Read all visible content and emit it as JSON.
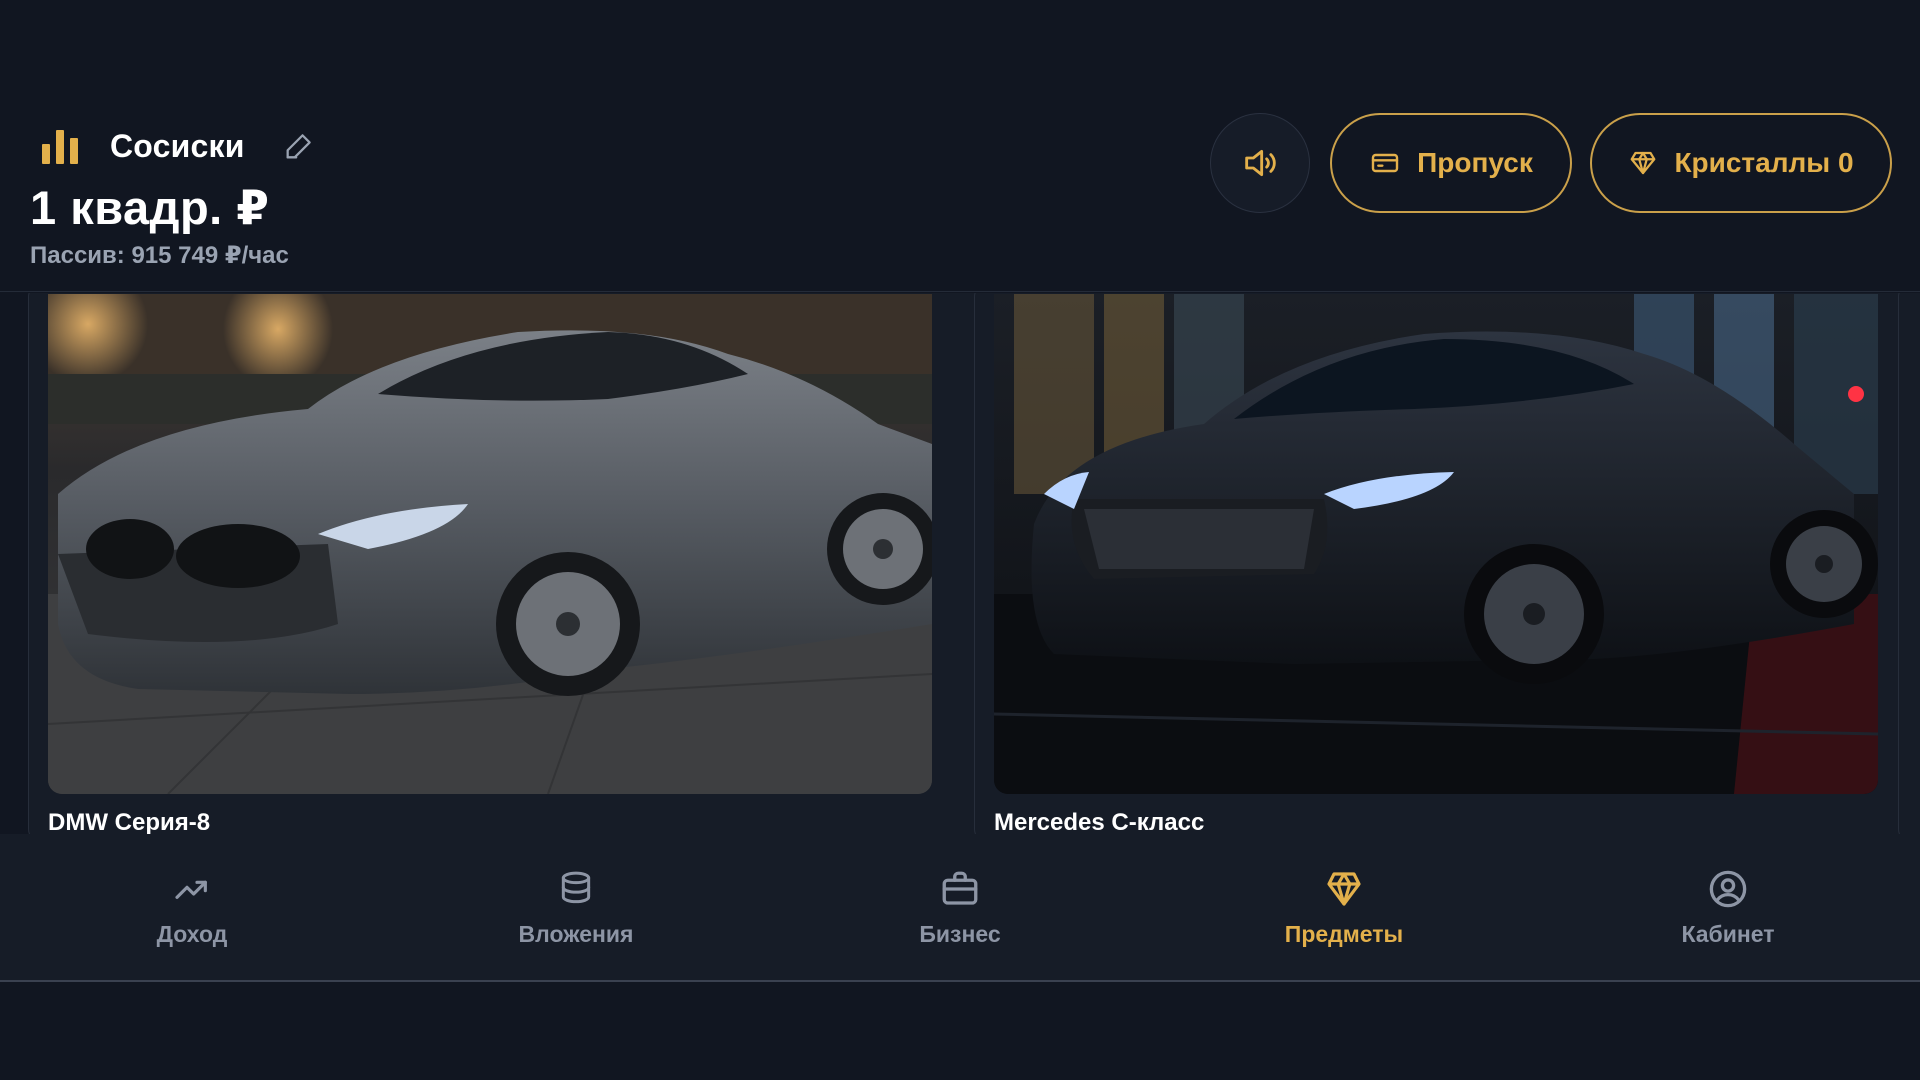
{
  "header": {
    "group_icon": "bar-chart-icon",
    "group_name": "Сосиски",
    "edit_icon": "pencil-icon",
    "balance": "1 квадр. ₽",
    "passive": "Пассив: 915 749 ₽/час",
    "sound_icon": "speaker-icon",
    "pass_button": {
      "icon": "ticket-icon",
      "label": "Пропуск"
    },
    "crystals_button": {
      "icon": "diamond-icon",
      "label": "Кристаллы 0"
    }
  },
  "items": [
    {
      "title": "DMW Серия-8",
      "image": "grey BMW 8 series coupe parked on cobblestones at dusk"
    },
    {
      "title": "Mercedes C-класс",
      "image": "black Mercedes C-class on wet city street at night"
    }
  ],
  "nav": {
    "active_tab": "Предметы",
    "items": [
      {
        "label": "Доход",
        "icon": "trending-up-icon"
      },
      {
        "label": "Вложения",
        "icon": "database-icon"
      },
      {
        "label": "Бизнес",
        "icon": "briefcase-icon"
      },
      {
        "label": "Предметы",
        "icon": "diamond-icon"
      },
      {
        "label": "Кабинет",
        "icon": "user-circle-icon"
      }
    ]
  },
  "colors": {
    "background": "#111621",
    "card": "#161c27",
    "accent": "#e3b04b",
    "muted": "#8d95a5"
  }
}
